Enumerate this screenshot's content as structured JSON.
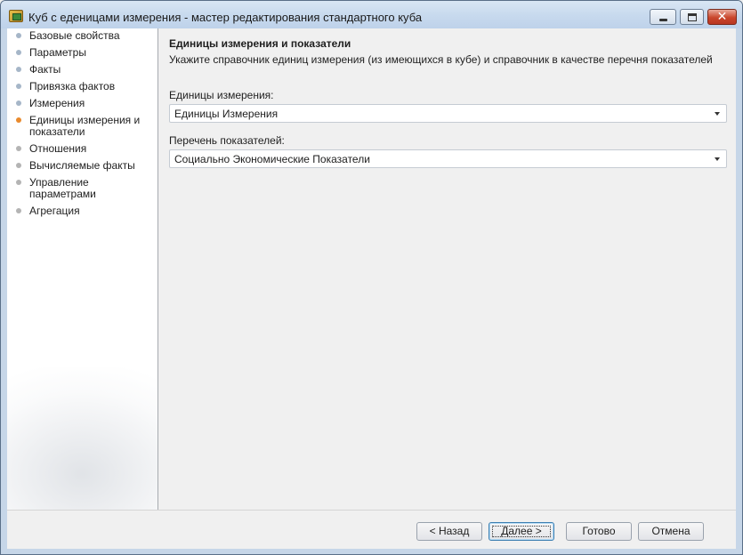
{
  "window": {
    "title": "Куб с еденицами измерения - мастер редактирования стандартного куба"
  },
  "sidebar": {
    "steps": [
      {
        "label": "Базовые свойства",
        "state": "visited"
      },
      {
        "label": "Параметры",
        "state": "visited"
      },
      {
        "label": "Факты",
        "state": "visited"
      },
      {
        "label": "Привязка фактов",
        "state": "visited"
      },
      {
        "label": "Измерения",
        "state": "visited"
      },
      {
        "label": "Единицы измерения и показатели",
        "state": "current"
      },
      {
        "label": "Отношения",
        "state": "todo"
      },
      {
        "label": "Вычисляемые факты",
        "state": "todo"
      },
      {
        "label": "Управление параметрами",
        "state": "todo"
      },
      {
        "label": "Агрегация",
        "state": "todo"
      }
    ]
  },
  "page": {
    "title": "Единицы измерения и показатели",
    "description": "Укажите справочник единиц измерения  (из имеющихся в кубе) и справочник в качестве перечня показателей",
    "units_label": "Единицы измерения:",
    "units_value": "Единицы Измерения",
    "indicators_label": "Перечень показателей:",
    "indicators_value": "Социально Экономические Показатели"
  },
  "footer": {
    "back_label": "< Назад",
    "next_label": "Далее >",
    "finish_label": "Готово",
    "cancel_label": "Отмена"
  },
  "colors": {
    "current_step": "#e98a2d",
    "visited_step": "#a6b6c8",
    "todo_step": "#b4b4b4",
    "titlebar": "#c8daee",
    "close_button": "#c9462c"
  }
}
